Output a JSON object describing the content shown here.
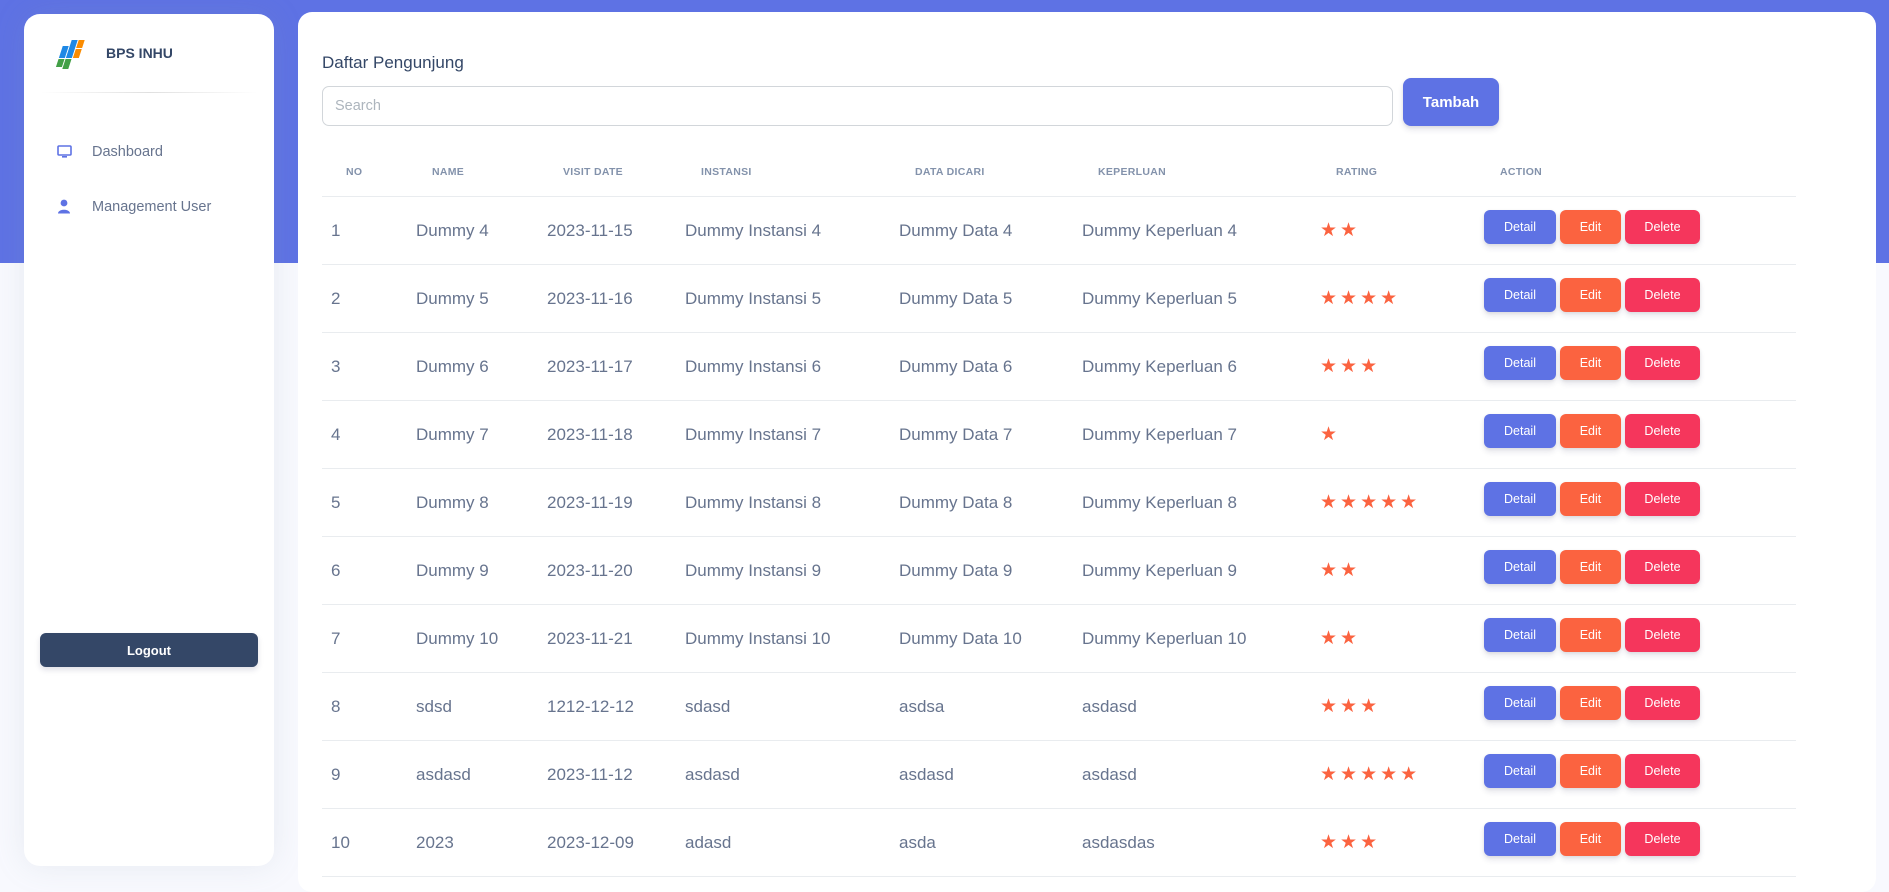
{
  "brand": {
    "name": "BPS INHU",
    "logo_colors": [
      "#1e88e5",
      "#43a047",
      "#fb8c00"
    ]
  },
  "sidebar": {
    "items": [
      {
        "label": "Dashboard",
        "icon": "monitor-icon"
      },
      {
        "label": "Management User",
        "icon": "user-icon"
      }
    ],
    "logout_label": "Logout"
  },
  "main": {
    "title": "Daftar Pengunjung",
    "search_placeholder": "Search",
    "add_button_label": "Tambah"
  },
  "table": {
    "headers": [
      "NO",
      "NAME",
      "VISIT DATE",
      "INSTANSI",
      "DATA DICARI",
      "KEPERLUAN",
      "RATING",
      "ACTION"
    ],
    "action_labels": {
      "detail": "Detail",
      "edit": "Edit",
      "delete": "Delete"
    },
    "rows": [
      {
        "no": "1",
        "name": "Dummy 4",
        "visit_date": "2023-11-15",
        "instansi": "Dummy Instansi 4",
        "data_dicari": "Dummy Data 4",
        "keperluan": "Dummy Keperluan 4",
        "rating": 2
      },
      {
        "no": "2",
        "name": "Dummy 5",
        "visit_date": "2023-11-16",
        "instansi": "Dummy Instansi 5",
        "data_dicari": "Dummy Data 5",
        "keperluan": "Dummy Keperluan 5",
        "rating": 4
      },
      {
        "no": "3",
        "name": "Dummy 6",
        "visit_date": "2023-11-17",
        "instansi": "Dummy Instansi 6",
        "data_dicari": "Dummy Data 6",
        "keperluan": "Dummy Keperluan 6",
        "rating": 3
      },
      {
        "no": "4",
        "name": "Dummy 7",
        "visit_date": "2023-11-18",
        "instansi": "Dummy Instansi 7",
        "data_dicari": "Dummy Data 7",
        "keperluan": "Dummy Keperluan 7",
        "rating": 1
      },
      {
        "no": "5",
        "name": "Dummy 8",
        "visit_date": "2023-11-19",
        "instansi": "Dummy Instansi 8",
        "data_dicari": "Dummy Data 8",
        "keperluan": "Dummy Keperluan 8",
        "rating": 5
      },
      {
        "no": "6",
        "name": "Dummy 9",
        "visit_date": "2023-11-20",
        "instansi": "Dummy Instansi 9",
        "data_dicari": "Dummy Data 9",
        "keperluan": "Dummy Keperluan 9",
        "rating": 2
      },
      {
        "no": "7",
        "name": "Dummy 10",
        "visit_date": "2023-11-21",
        "instansi": "Dummy Instansi 10",
        "data_dicari": "Dummy Data 10",
        "keperluan": "Dummy Keperluan 10",
        "rating": 2
      },
      {
        "no": "8",
        "name": "sdsd",
        "visit_date": "1212-12-12",
        "instansi": "sdasd",
        "data_dicari": "asdsa",
        "keperluan": "asdasd",
        "rating": 3
      },
      {
        "no": "9",
        "name": "asdasd",
        "visit_date": "2023-11-12",
        "instansi": "asdasd",
        "data_dicari": "asdasd",
        "keperluan": "asdasd",
        "rating": 5
      },
      {
        "no": "10",
        "name": "2023",
        "visit_date": "2023-12-09",
        "instansi": "adasd",
        "data_dicari": "asda",
        "keperluan": "asdasdas",
        "rating": 3
      }
    ]
  },
  "colors": {
    "primary": "#5e72e4",
    "warning": "#fb6340",
    "danger": "#f5365c",
    "dark": "#344767",
    "star": "#fb6340"
  }
}
